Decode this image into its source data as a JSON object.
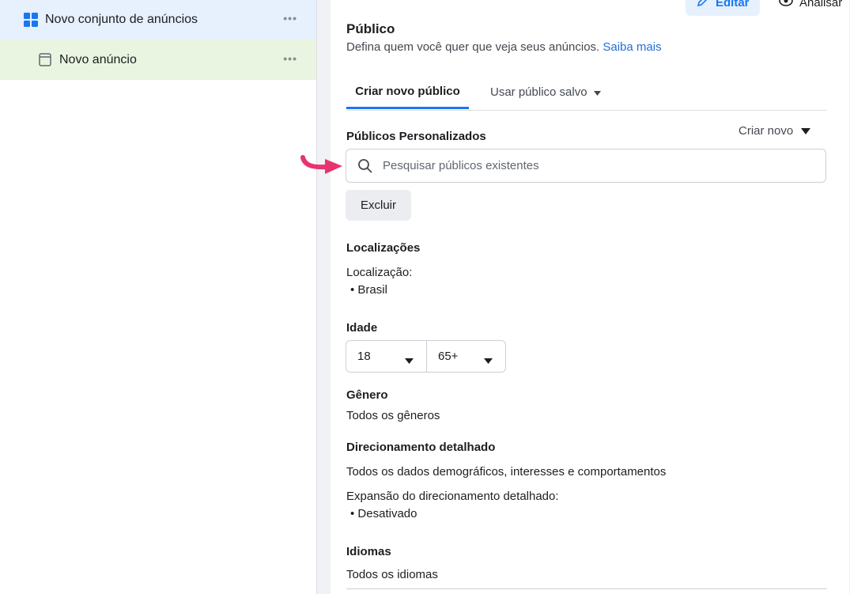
{
  "sidebar": {
    "adset_label": "Novo conjunto de anúncios",
    "ad_label": "Novo anúncio",
    "more_label": "•••"
  },
  "toolbar": {
    "edit_label": "Editar",
    "analyze_label": "Analisar"
  },
  "audience": {
    "title": "Público",
    "subtitle": "Defina quem você quer que veja seus anúncios.",
    "learn_more": "Saiba mais",
    "tabs": [
      {
        "label": "Criar novo público",
        "active": true
      },
      {
        "label": "Usar público salvo",
        "active": false
      }
    ],
    "custom_audiences_label": "Públicos Personalizados",
    "create_new_label": "Criar novo",
    "search_placeholder": "Pesquisar públicos existentes",
    "exclude_label": "Excluir",
    "locations_label": "Localizações",
    "location_caption": "Localização:",
    "location_value": "Brasil",
    "age_label": "Idade",
    "age_min": "18",
    "age_max": "65+",
    "gender_label": "Gênero",
    "gender_value": "Todos os gêneros",
    "targeting_label": "Direcionamento detalhado",
    "targeting_value": "Todos os dados demográficos, interesses e comportamentos",
    "expansion_caption": "Expansão do direcionamento detalhado:",
    "expansion_value": "Desativado",
    "languages_label": "Idiomas",
    "languages_value": "Todos os idiomas"
  },
  "colors": {
    "accent": "#1877f2",
    "link": "#216fdb",
    "adset_row_bg": "#e7f0fd",
    "ad_row_bg": "#eaf5e1",
    "annotation_arrow": "#e8336f"
  }
}
